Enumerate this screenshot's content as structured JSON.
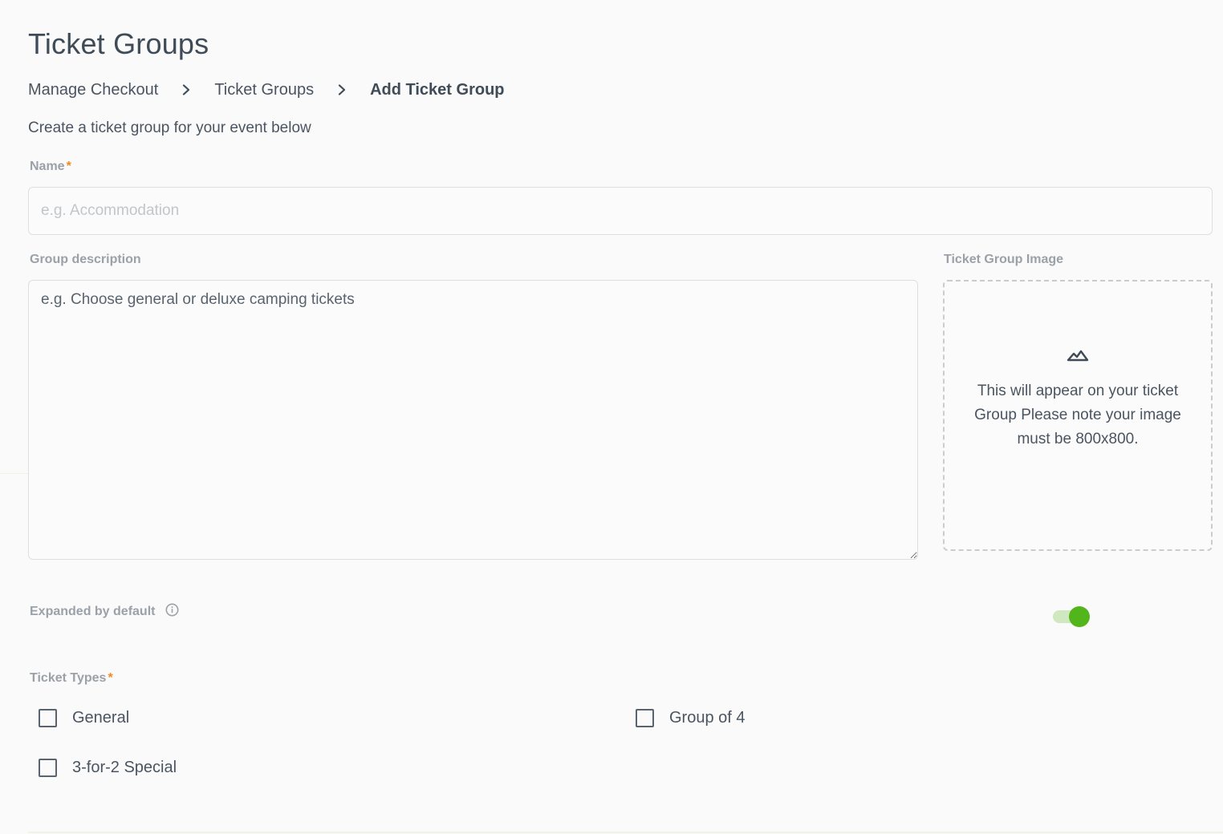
{
  "page": {
    "title": "Ticket Groups"
  },
  "breadcrumb": [
    {
      "label": "Manage Checkout"
    },
    {
      "label": "Ticket Groups"
    },
    {
      "label": "Add Ticket Group"
    }
  ],
  "intro": "Create a ticket group for your event below",
  "form": {
    "name": {
      "label": "Name",
      "required_mark": "*",
      "placeholder": "e.g. Accommodation",
      "value": ""
    },
    "description": {
      "label": "Group description",
      "placeholder": "e.g. Choose general or deluxe camping tickets",
      "value": ""
    },
    "image": {
      "label": "Ticket Group Image",
      "icon": "mountain-image-icon",
      "hint": "This will appear on your ticket Group Please note your image must be 800x800."
    },
    "expanded": {
      "label": "Expanded by default",
      "info_icon": "info-circle-icon",
      "enabled": true
    },
    "ticket_types": {
      "label": "Ticket Types",
      "required_mark": "*",
      "options": [
        {
          "label": "General",
          "checked": false
        },
        {
          "label": "Group of 4",
          "checked": false
        },
        {
          "label": "3-for-2 Special",
          "checked": false
        }
      ]
    }
  },
  "colors": {
    "required": "#f08a24",
    "toggle_on": "#52b51c",
    "toggle_track": "#cfe8bf",
    "text": "#4a5561",
    "label": "#9aa1a8"
  }
}
